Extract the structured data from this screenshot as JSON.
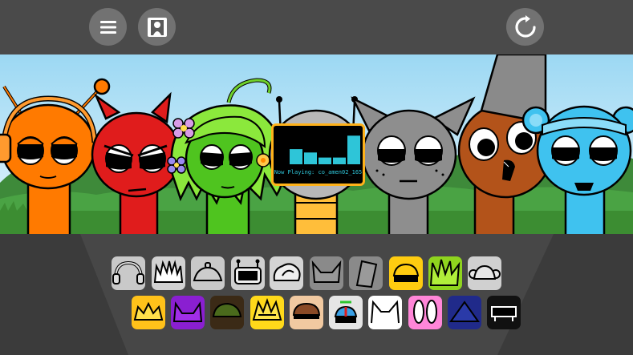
{
  "top_bar": {
    "menu_button": {
      "icon": "hamburger-menu-icon"
    },
    "profile_button": {
      "icon": "portrait-frame-icon"
    },
    "reset_button": {
      "icon": "circular-reset-icon"
    }
  },
  "now_playing": {
    "text": "Now Playing: co_amen02_165",
    "level_bars": [
      0.45,
      0.35,
      0.2,
      0.2,
      0.85
    ]
  },
  "characters": [
    {
      "name": "orange-headphones",
      "color": "#ff7a00"
    },
    {
      "name": "red-devil",
      "color": "#e01c1c"
    },
    {
      "name": "green-vine-hair",
      "color": "#4fc41f"
    },
    {
      "name": "gray-robot-player",
      "color": "#b8b8b8"
    },
    {
      "name": "gray-cat",
      "color": "#8e8e8e"
    },
    {
      "name": "brown-bucket-hat",
      "color": "#b3531a"
    },
    {
      "name": "blue-bear-headband",
      "color": "#3fc2ef"
    }
  ],
  "sound_slots_row1": [
    {
      "name": "headphones",
      "bg": "#c9c9c9"
    },
    {
      "name": "spiky",
      "bg": "#d2d2d2"
    },
    {
      "name": "lid-hat",
      "bg": "#c9c9c9"
    },
    {
      "name": "robot-antenna",
      "bg": "#cfcfcf"
    },
    {
      "name": "cloud-hat",
      "bg": "#d4d4d4"
    },
    {
      "name": "cat-ears",
      "bg": "#8a8a8a"
    },
    {
      "name": "bucket",
      "bg": "#8a8a8a"
    },
    {
      "name": "yellow-cap",
      "bg": "#ffcc10"
    },
    {
      "name": "lime-spikes",
      "bg": "#8fd41e"
    },
    {
      "name": "gray-bear",
      "bg": "#d0d0d0"
    }
  ],
  "sound_slots_row2": [
    {
      "name": "crown",
      "bg": "#ffc21a"
    },
    {
      "name": "purple-horns",
      "bg": "#8a1fd1"
    },
    {
      "name": "dark-green-hat",
      "bg": "#3b2a16"
    },
    {
      "name": "yellow-star",
      "bg": "#ffd91a"
    },
    {
      "name": "hair-band",
      "bg": "#f1c9a1"
    },
    {
      "name": "propeller-hat",
      "bg": "#e5e5e5"
    },
    {
      "name": "white-cat",
      "bg": "#ffffff"
    },
    {
      "name": "bunny-ears",
      "bg": "#ff86d8"
    },
    {
      "name": "navy-hood",
      "bg": "#202a8a"
    },
    {
      "name": "black-bench",
      "bg": "#111111"
    }
  ]
}
